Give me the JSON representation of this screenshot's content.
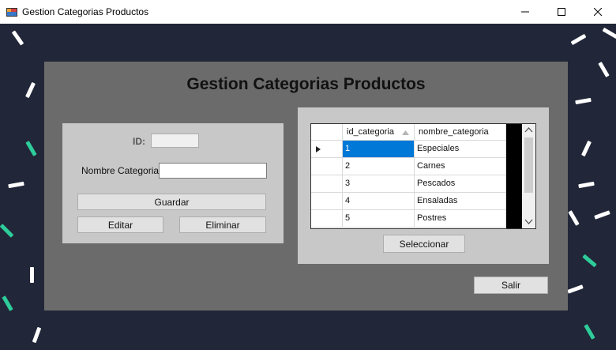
{
  "window": {
    "title": "Gestion Categorias Productos",
    "controls": {
      "minimize": "─",
      "maximize": "☐",
      "close": "✕"
    }
  },
  "form": {
    "heading": "Gestion Categorias Productos",
    "id_label": "ID:",
    "id_value": "",
    "nombre_label": "Nombre Categoria:",
    "nombre_value": "",
    "guardar_label": "Guardar",
    "editar_label": "Editar",
    "eliminar_label": "Eliminar",
    "seleccionar_label": "Seleccionar",
    "salir_label": "Salir"
  },
  "grid": {
    "columns": [
      "id_categoria",
      "nombre_categoria"
    ],
    "rows": [
      {
        "id": "1",
        "nombre": "Especiales",
        "selected": true
      },
      {
        "id": "2",
        "nombre": "Carnes",
        "selected": false
      },
      {
        "id": "3",
        "nombre": "Pescados",
        "selected": false
      },
      {
        "id": "4",
        "nombre": "Ensaladas",
        "selected": false
      },
      {
        "id": "5",
        "nombre": "Postres",
        "selected": false
      }
    ],
    "scroll_up": "⌃",
    "scroll_down": "⌄"
  },
  "colors": {
    "background": "#212638",
    "confetti_white": "#ffffff",
    "confetti_green": "#2ecc9a",
    "selection": "#0078d7"
  }
}
